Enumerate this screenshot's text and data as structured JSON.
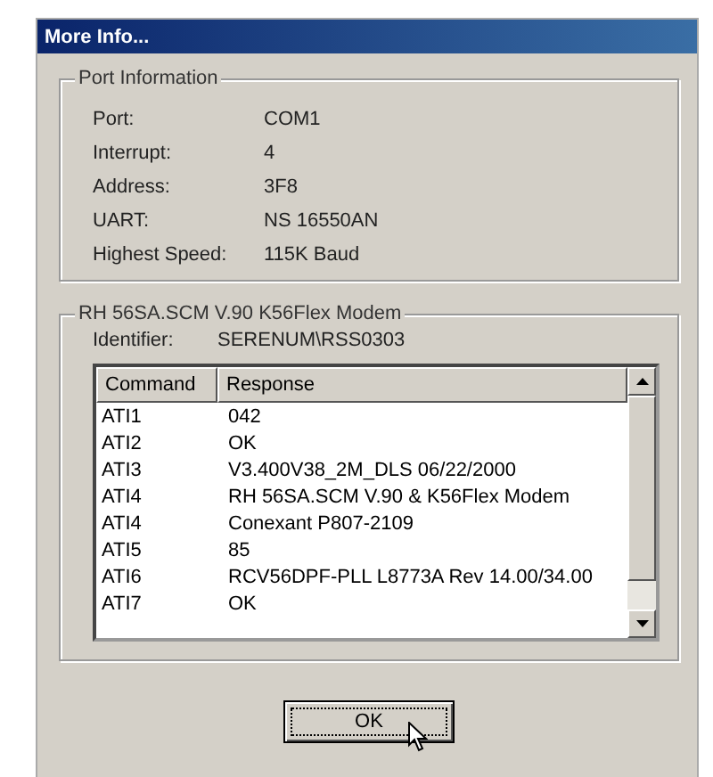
{
  "window": {
    "title": "More Info..."
  },
  "port_information": {
    "title": "Port Information",
    "fields": [
      {
        "label": "Port:",
        "value": "COM1"
      },
      {
        "label": "Interrupt:",
        "value": "4"
      },
      {
        "label": "Address:",
        "value": "3F8"
      },
      {
        "label": "UART:",
        "value": "NS 16550AN"
      },
      {
        "label": "Highest Speed:",
        "value": "115K Baud"
      }
    ]
  },
  "modem": {
    "title": "RH 56SA.SCM V.90 K56Flex Modem",
    "identifier_label": "Identifier:",
    "identifier": "SERENUM\\RSS0303",
    "table": {
      "columns": [
        "Command",
        "Response"
      ],
      "rows": [
        [
          "ATI1",
          "042"
        ],
        [
          "ATI2",
          "OK"
        ],
        [
          "ATI3",
          "V3.400V38_2M_DLS 06/22/2000"
        ],
        [
          "ATI4",
          "RH 56SA.SCM V.90 & K56Flex Modem"
        ],
        [
          "ATI4",
          "Conexant P807-2109"
        ],
        [
          "ATI5",
          "85"
        ],
        [
          "ATI6",
          "RCV56DPF-PLL L8773A Rev 14.00/34.00"
        ],
        [
          "ATI7",
          "OK"
        ]
      ]
    }
  },
  "buttons": [
    {
      "label": "OK",
      "focused": true
    }
  ]
}
